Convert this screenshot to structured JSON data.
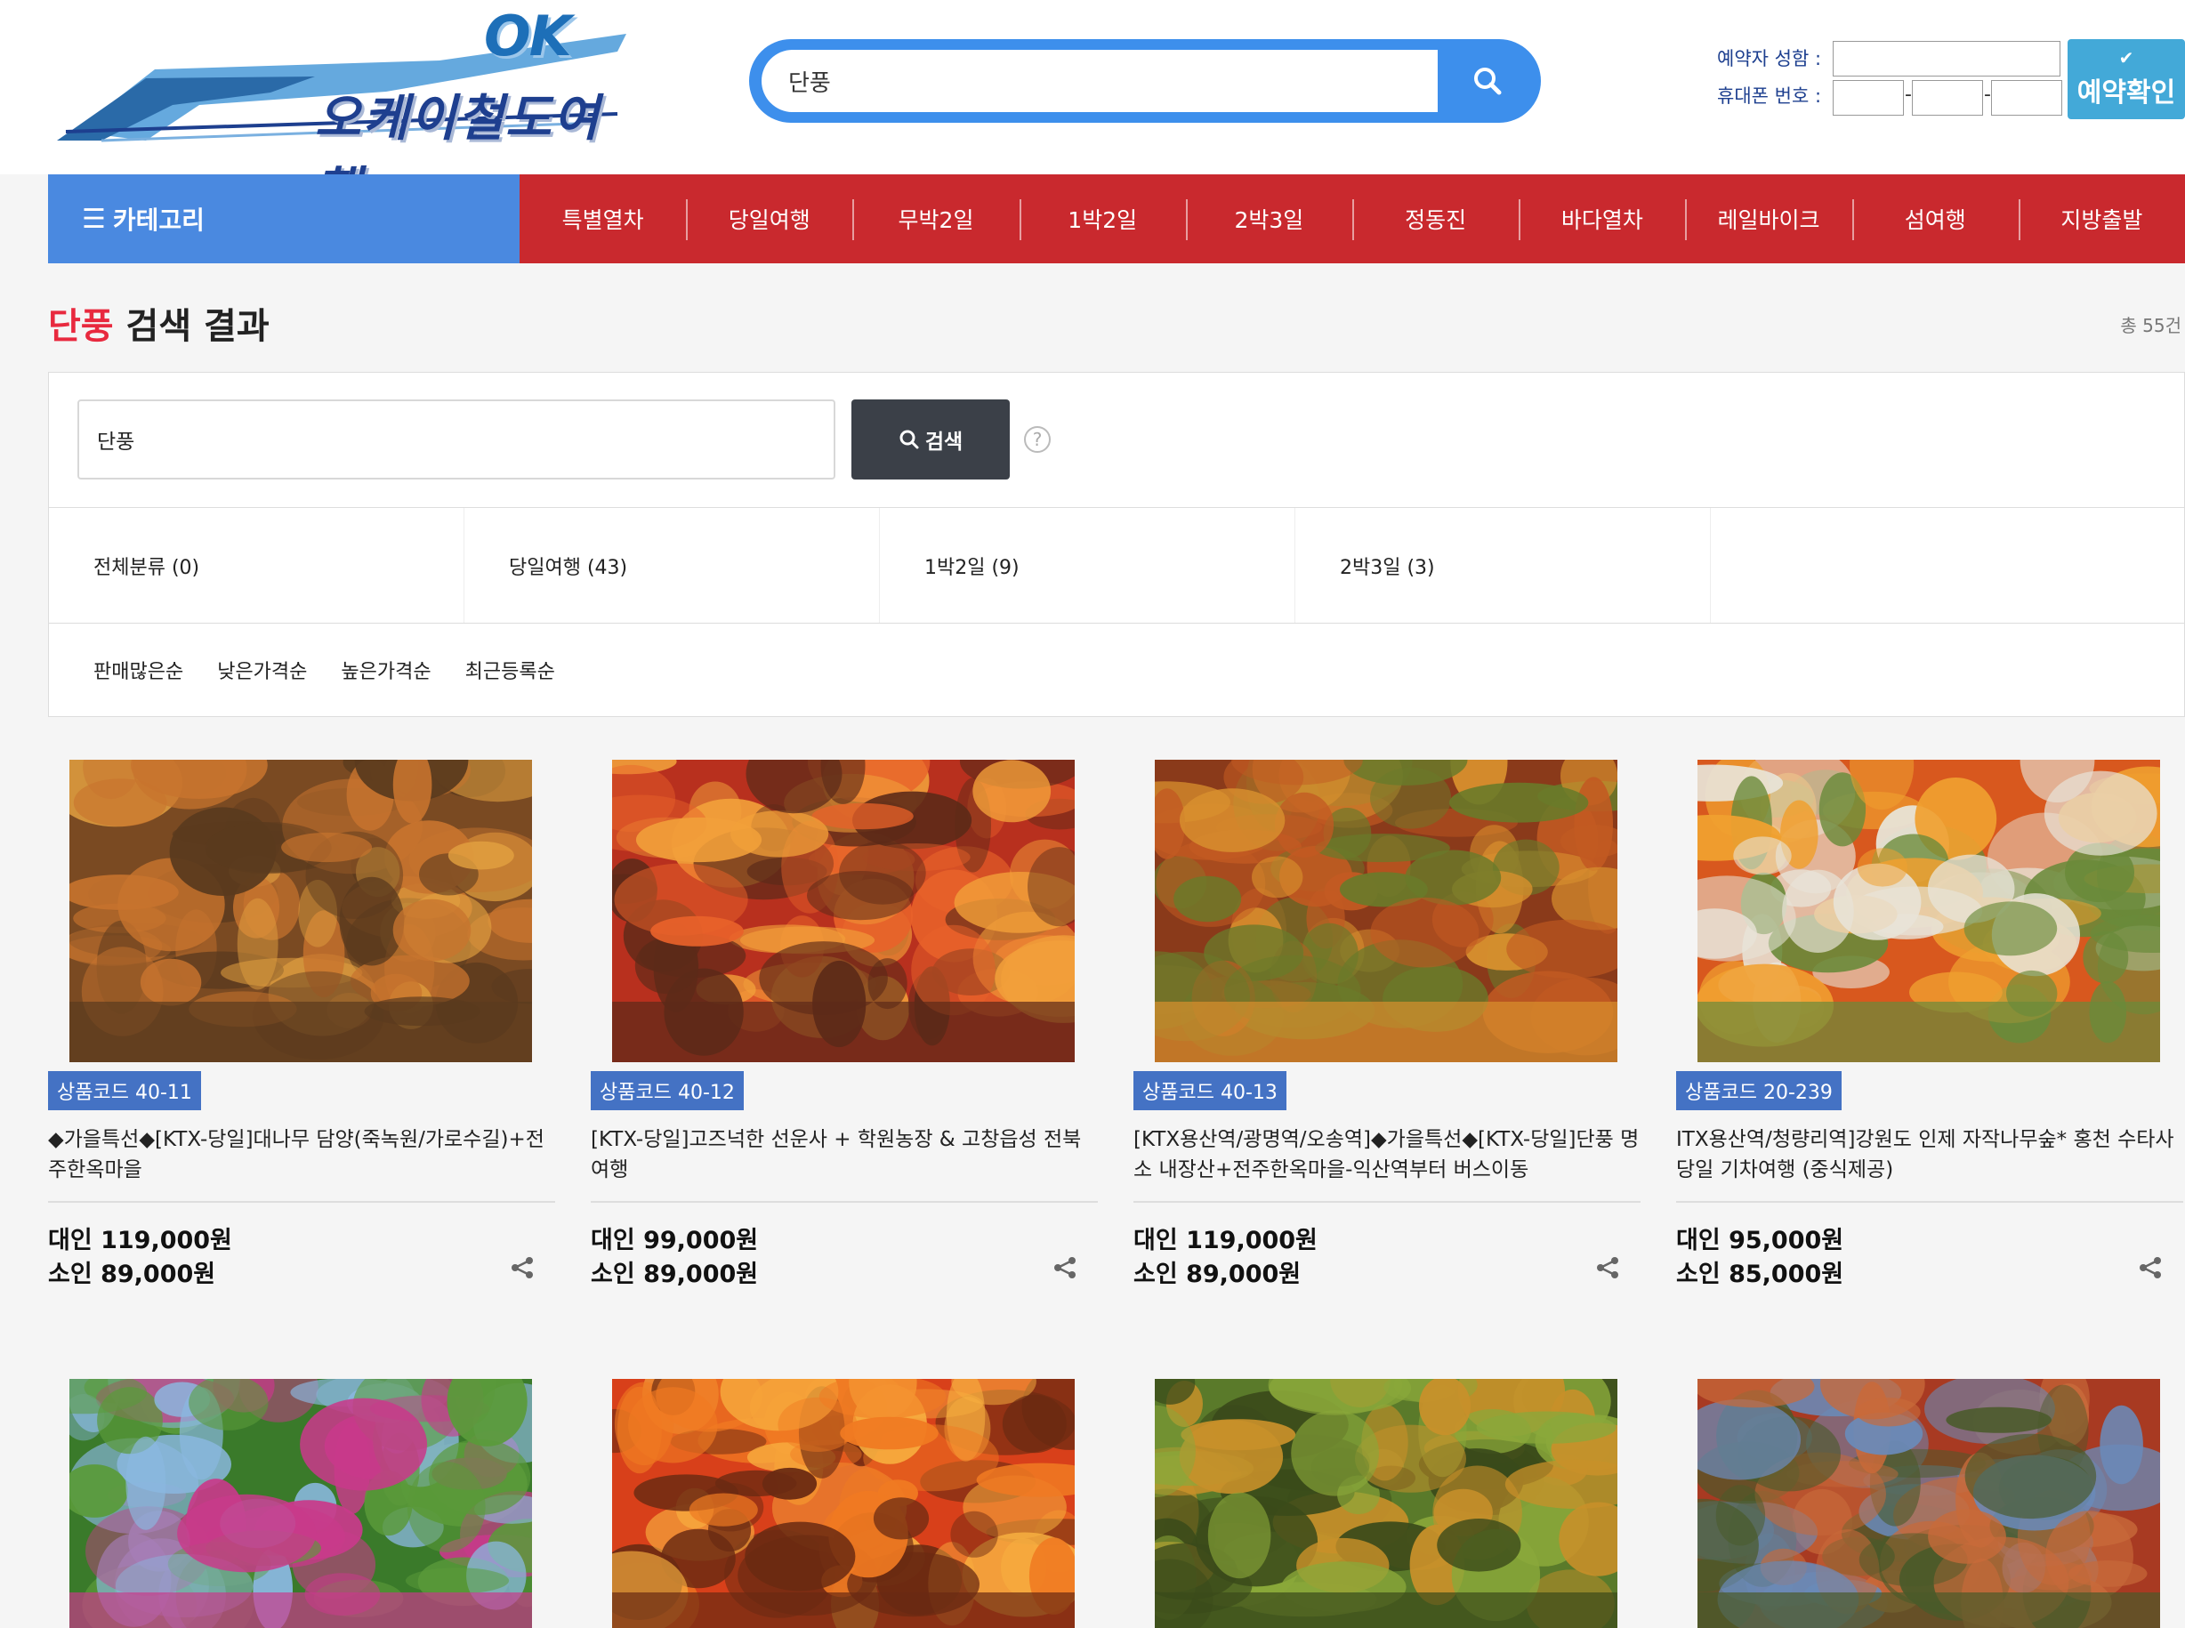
{
  "header": {
    "logo_ok": "OK",
    "logo_name": "오케이철도여행",
    "search_value": "단풍",
    "reservation": {
      "name_label": "예약자 성함 :",
      "phone_label": "휴대폰 번호 :",
      "dash": "-",
      "button_label": "예약확인"
    }
  },
  "nav": {
    "category_label": "카테고리",
    "items": [
      "특별열차",
      "당일여행",
      "무박2일",
      "1박2일",
      "2박3일",
      "정동진",
      "바다열차",
      "레일바이크",
      "섬여행",
      "지방출발"
    ]
  },
  "results": {
    "keyword": "단풍",
    "title_suffix": " 검색 결과",
    "total": "총 55건"
  },
  "filter": {
    "input_value": "단풍",
    "search_button": "검색",
    "help": "?",
    "categories": [
      "전체분류 (0)",
      "당일여행 (43)",
      "1박2일 (9)",
      "2박3일 (3)"
    ],
    "sorts": [
      "판매많은순",
      "낮은가격순",
      "높은가격순",
      "최근등록순"
    ]
  },
  "products": [
    {
      "code": "상품코드 40-11",
      "name": "◆가을특선◆[KTX-당일]대나무 담양(죽녹원/가로수길)+전주한옥마을",
      "adult": "대인 119,000원",
      "child": "소인 89,000원",
      "palette": [
        "#7a4a22",
        "#c8742e",
        "#e2a040",
        "#5a3a1e"
      ]
    },
    {
      "code": "상품코드 40-12",
      "name": "[KTX-당일]고즈넉한 선운사 + 학원농장 & 고창읍성 전북여행",
      "adult": "대인 99,000원",
      "child": "소인 89,000원",
      "palette": [
        "#b8301e",
        "#e8622a",
        "#f2a03a",
        "#5c2a18"
      ]
    },
    {
      "code": "상품코드 40-13",
      "name": "[KTX용산역/광명역/오송역]◆가을특선◆[KTX-당일]단풍 명소 내장산+전주한옥마을-익산역부터 버스이동",
      "adult": "대인 119,000원",
      "child": "소인 89,000원",
      "palette": [
        "#8a3a1a",
        "#c25a22",
        "#6a7a2a",
        "#d8902e"
      ]
    },
    {
      "code": "상품코드 20-239",
      "name": "ITX용산역/청량리역]강원도 인제 자작나무숲* 홍천 수타사 당일 기차여행 (중식제공)",
      "adult": "대인 95,000원",
      "child": "소인 85,000원",
      "palette": [
        "#d8581e",
        "#f0a030",
        "#e8e4d8",
        "#6a8a3a"
      ]
    },
    {
      "palette": [
        "#3a7a2a",
        "#8ab8e0",
        "#5a9a3a",
        "#c83a8a"
      ]
    },
    {
      "palette": [
        "#d8401a",
        "#f07a22",
        "#f8b040",
        "#6a2a12"
      ]
    },
    {
      "palette": [
        "#5a7a2a",
        "#c8902a",
        "#8aa83a",
        "#3a4a1a"
      ]
    },
    {
      "palette": [
        "#a83a22",
        "#6a8ab8",
        "#c86a3a",
        "#4a5a2a"
      ]
    }
  ]
}
